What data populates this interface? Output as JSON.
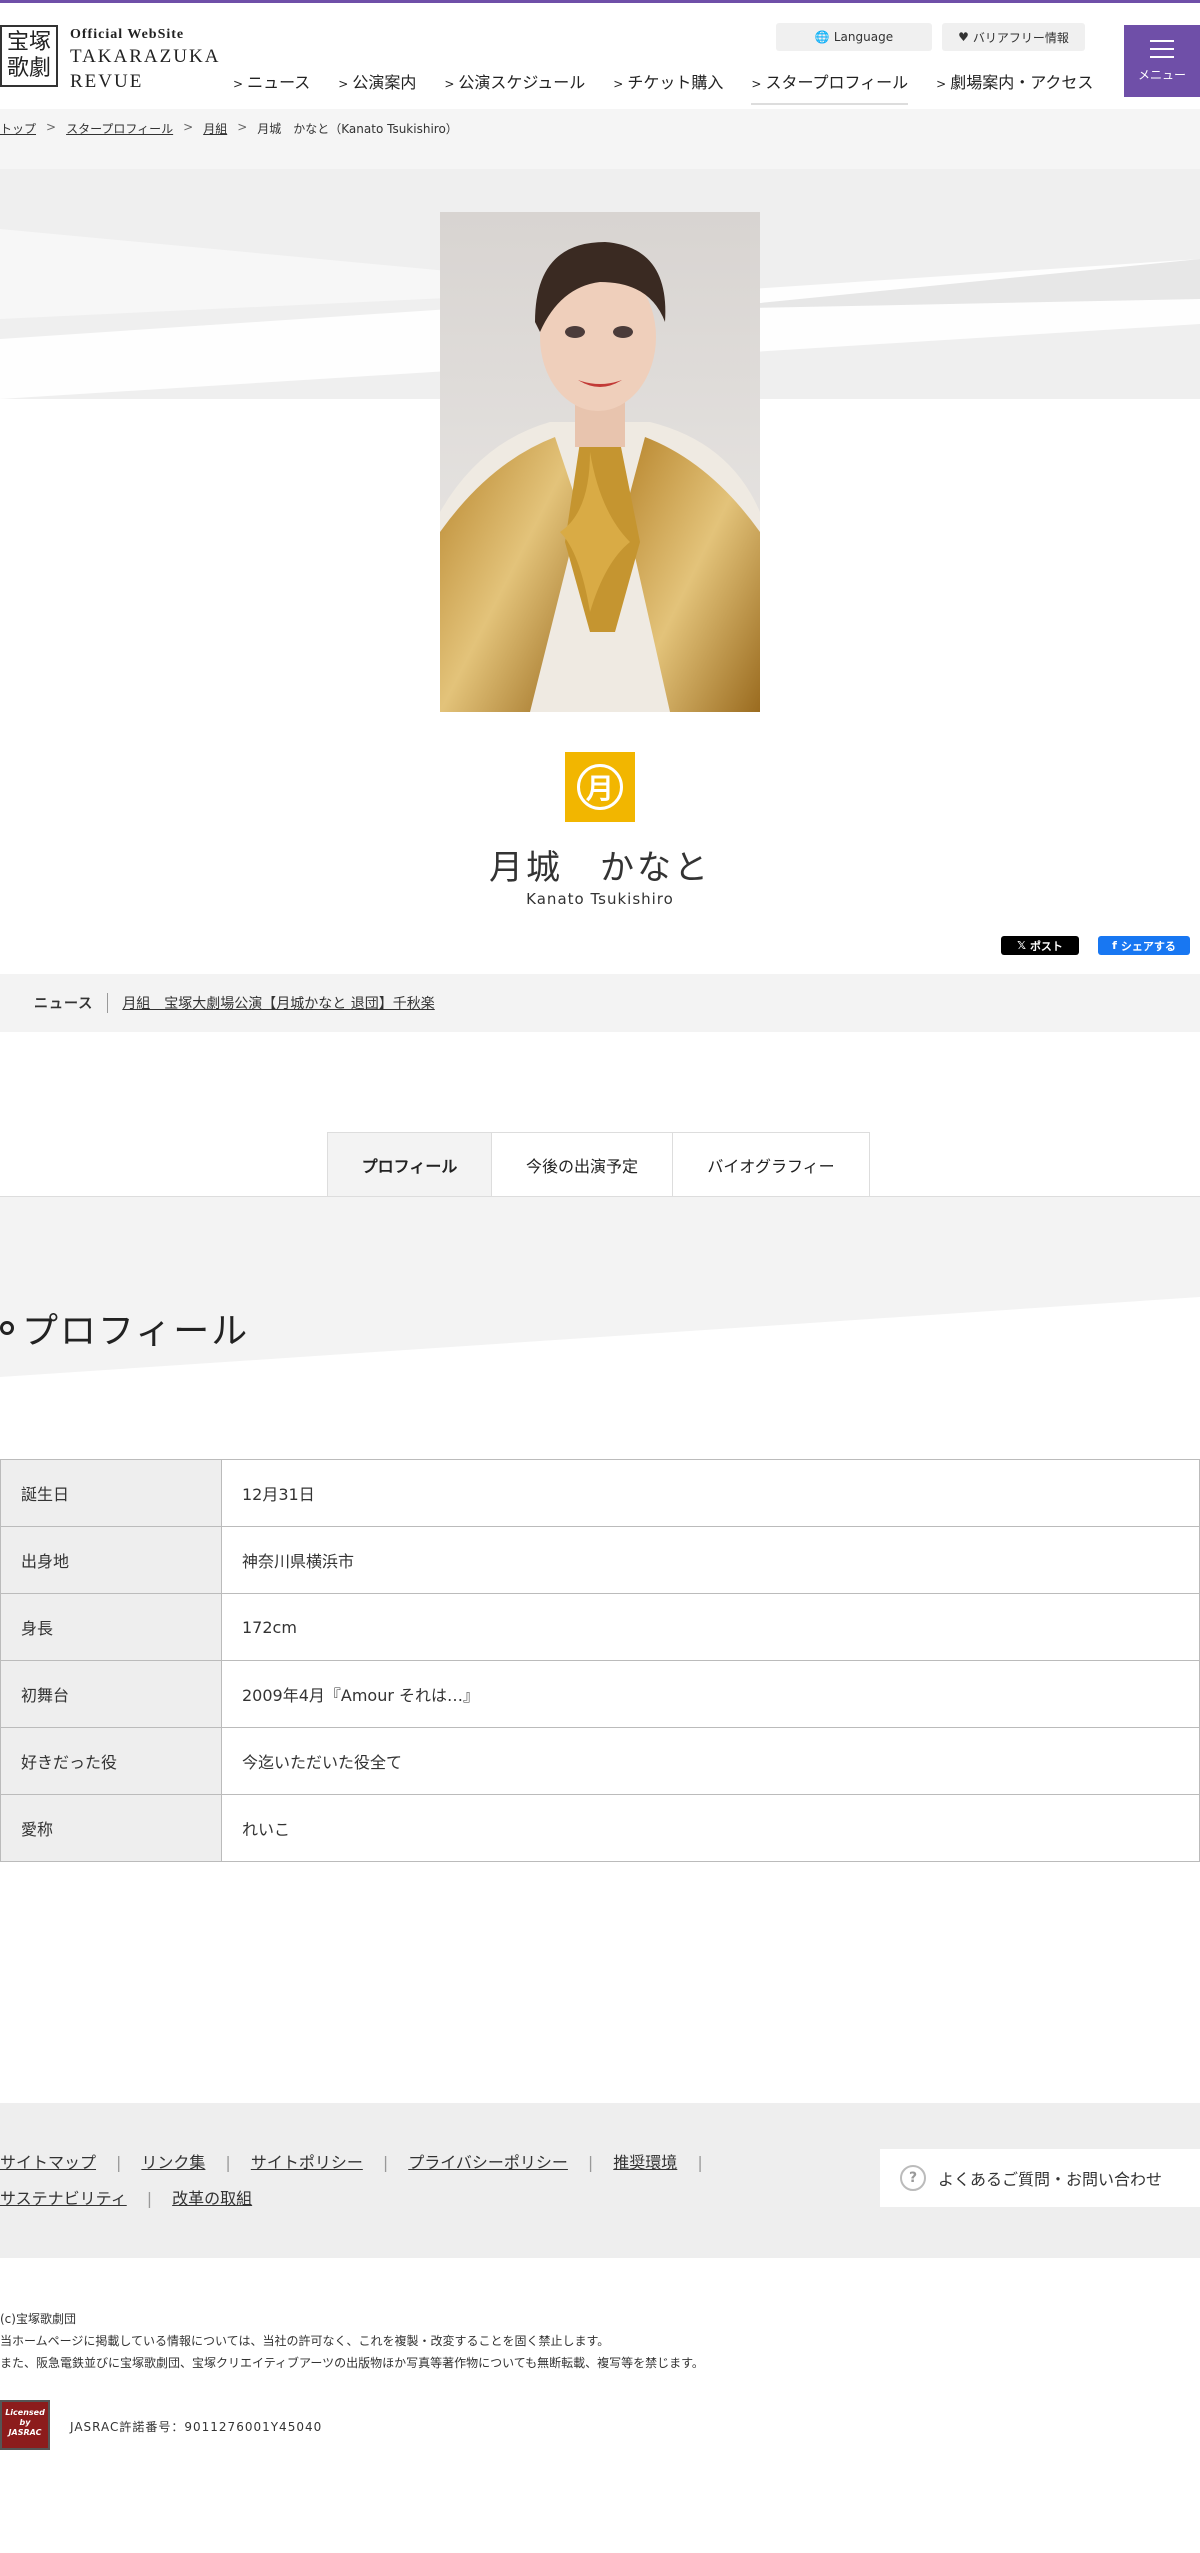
{
  "brand": {
    "logo_kanji_1": "宝塚",
    "logo_kanji_2": "歌劇",
    "official": "Official WebSite",
    "name_1": "TAKARAZUKA",
    "name_2": "REVUE"
  },
  "utility": {
    "language": "Language",
    "barrier_free": "バリアフリー情報"
  },
  "nav": [
    "ニュース",
    "公演案内",
    "公演スケジュール",
    "チケット購入",
    "スタープロフィール",
    "劇場案内・アクセス"
  ],
  "menu_label": "メニュー",
  "breadcrumb": {
    "top": "トップ",
    "star_profile": "スタープロフィール",
    "troupe": "月組",
    "current": "月城　かなと（Kanato Tsukishiro）"
  },
  "profile_header": {
    "troupe_glyph": "月",
    "name": "月城　かなと",
    "name_roman": "Kanato Tsukishiro"
  },
  "share": {
    "x": "ポスト",
    "facebook": "シェアする"
  },
  "news": {
    "label": "ニュース",
    "link": "月組　宝塚大劇場公演【月城かなと 退団】千秋楽"
  },
  "tabs": [
    "プロフィール",
    "今後の出演予定",
    "バイオグラフィー"
  ],
  "section_title": "プロフィール",
  "profile_rows": [
    {
      "label": "誕生日",
      "value": "12月31日"
    },
    {
      "label": "出身地",
      "value": "神奈川県横浜市"
    },
    {
      "label": "身長",
      "value": "172cm"
    },
    {
      "label": "初舞台",
      "value": "2009年4月『Amour それは…』"
    },
    {
      "label": "好きだった役",
      "value": "今迄いただいた役全て"
    },
    {
      "label": "愛称",
      "value": "れいこ"
    }
  ],
  "footer_links": [
    "サイトマップ",
    "リンク集",
    "サイトポリシー",
    "プライバシーポリシー",
    "推奨環境",
    "サステナビリティ",
    "改革の取組"
  ],
  "faq": "よくあるご質問・お問い合わせ",
  "copyright": [
    "(c)宝塚歌劇団",
    "当ホームページに掲載している情報については、当社の許可なく、これを複製・改変することを固く禁止します。",
    "また、阪急電鉄並びに宝塚歌劇団、宝塚クリエイティブアーツの出版物ほか写真等著作物についても無断転載、複写等を禁じます。"
  ],
  "jasrac": {
    "badge_1": "Licensed",
    "badge_2": "by",
    "badge_3": "JASRAC",
    "permit": "JASRAC許諾番号：9011276001Y45040"
  },
  "colors": {
    "brand_purple": "#6f4fa8",
    "troupe_yellow": "#f2b600",
    "x_black": "#000000",
    "facebook_blue": "#1877f2"
  }
}
